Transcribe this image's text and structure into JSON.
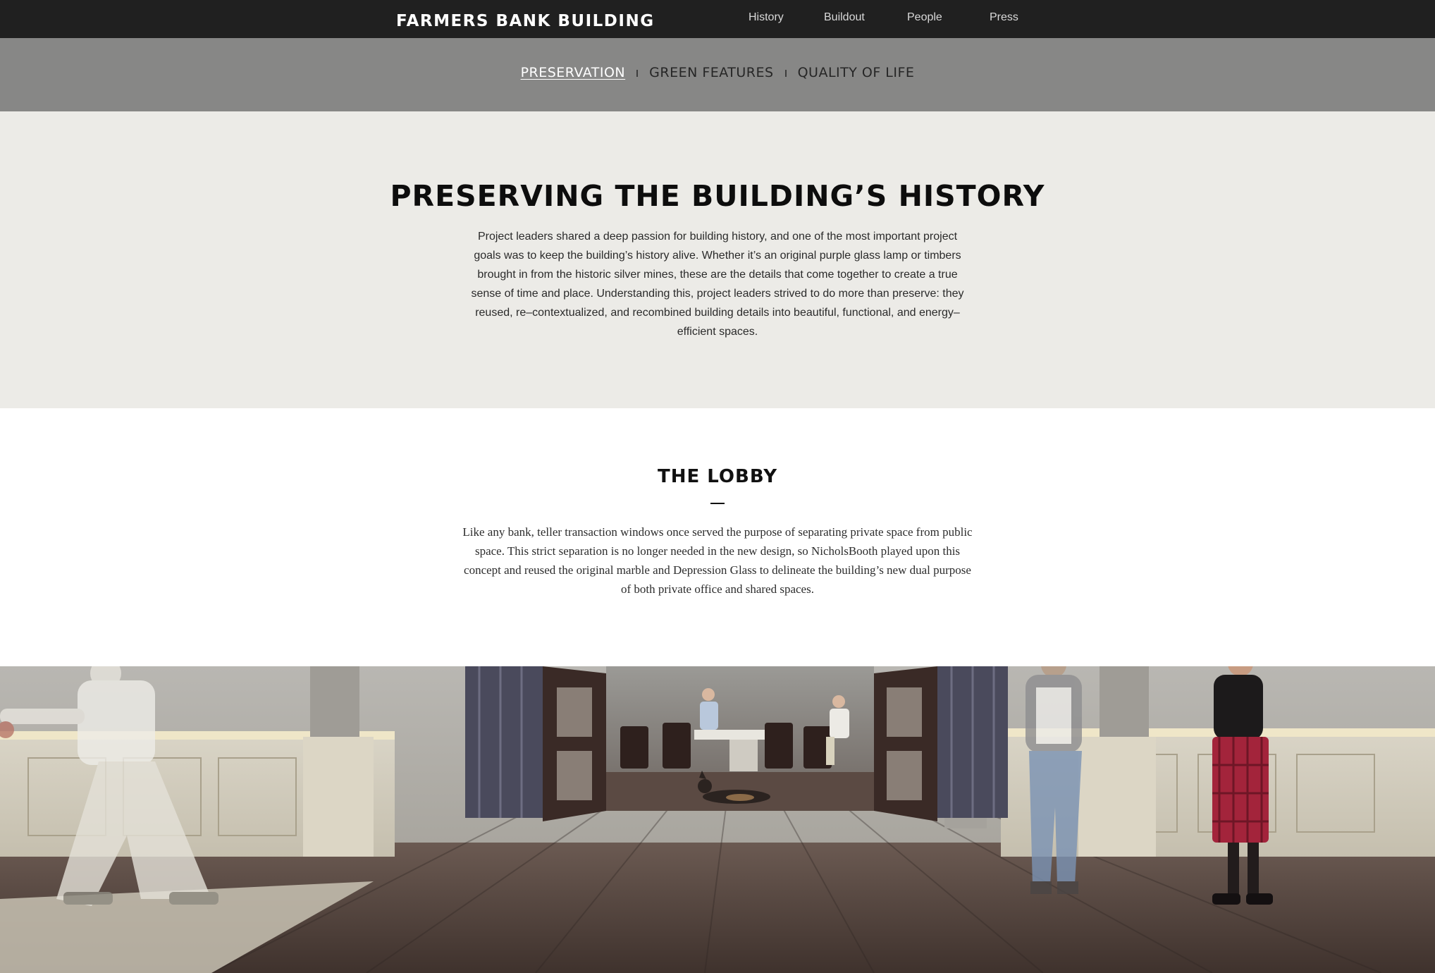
{
  "header": {
    "brand": "FARMERS BANK BUILDING",
    "nav": [
      "History",
      "Buildout",
      "People",
      "Press"
    ]
  },
  "subnav": {
    "items": [
      "PRESERVATION",
      "GREEN FEATURES",
      "QUALITY OF LIFE"
    ],
    "active": "PRESERVATION"
  },
  "history": {
    "title": "PRESERVING THE BUILDING’S HISTORY",
    "body": "Project leaders shared a deep passion for building history, and one of the most important project goals was to keep the building’s history alive. Whether it’s an original purple glass lamp or timbers brought in from the historic silver mines, these are the details that come together to create a true sense of time and place. Understanding this, project leaders strived to do more than preserve: they reused, re–contextualized, and recombined building details into beautiful, functional, and energy–efficient spaces."
  },
  "lobby": {
    "title": "THE LOBBY",
    "body": "Like any bank, teller transaction windows once served the purpose of separating private space from public space. This strict separation is no longer needed in the new design, so NicholsBooth played upon this concept and reused the original marble and Depression Glass to delineate the building’s new dual purpose of both private office and shared spaces."
  },
  "colors": {
    "topbar": "#202020",
    "subnav": "#878786",
    "history_bg": "#ecebe7",
    "accent_red": "#a3243b"
  }
}
